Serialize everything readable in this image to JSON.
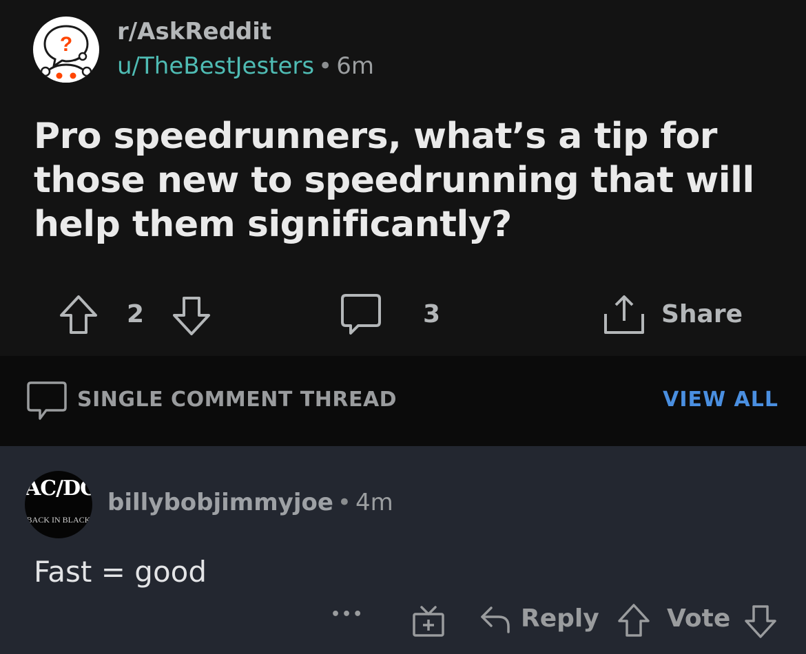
{
  "post": {
    "subreddit": "r/AskReddit",
    "author": "u/TheBestJesters",
    "separator": "•",
    "age": "6m",
    "title": "Pro speedrunners, what’s a tip for those new to speedrunning that will help them significantly?",
    "avatar_icon": "reddit-question-snoo-icon",
    "score": "2",
    "comments": "3",
    "share_label": "Share"
  },
  "thread": {
    "label": "SINGLE COMMENT THREAD",
    "view_all": "VIEW ALL"
  },
  "comment": {
    "avatar_logo": "AC/DC",
    "avatar_sub": "BACK IN BLACK",
    "author": "billybobjimmyjoe",
    "separator": "•",
    "age": "4m",
    "body": "Fast = good",
    "more_label": "•••",
    "reply_label": "Reply",
    "vote_label": "Vote"
  },
  "colors": {
    "background": "#131313",
    "comment_background": "#232730",
    "author_accent": "#4fbcb4",
    "link_accent": "#4a8fe0"
  }
}
